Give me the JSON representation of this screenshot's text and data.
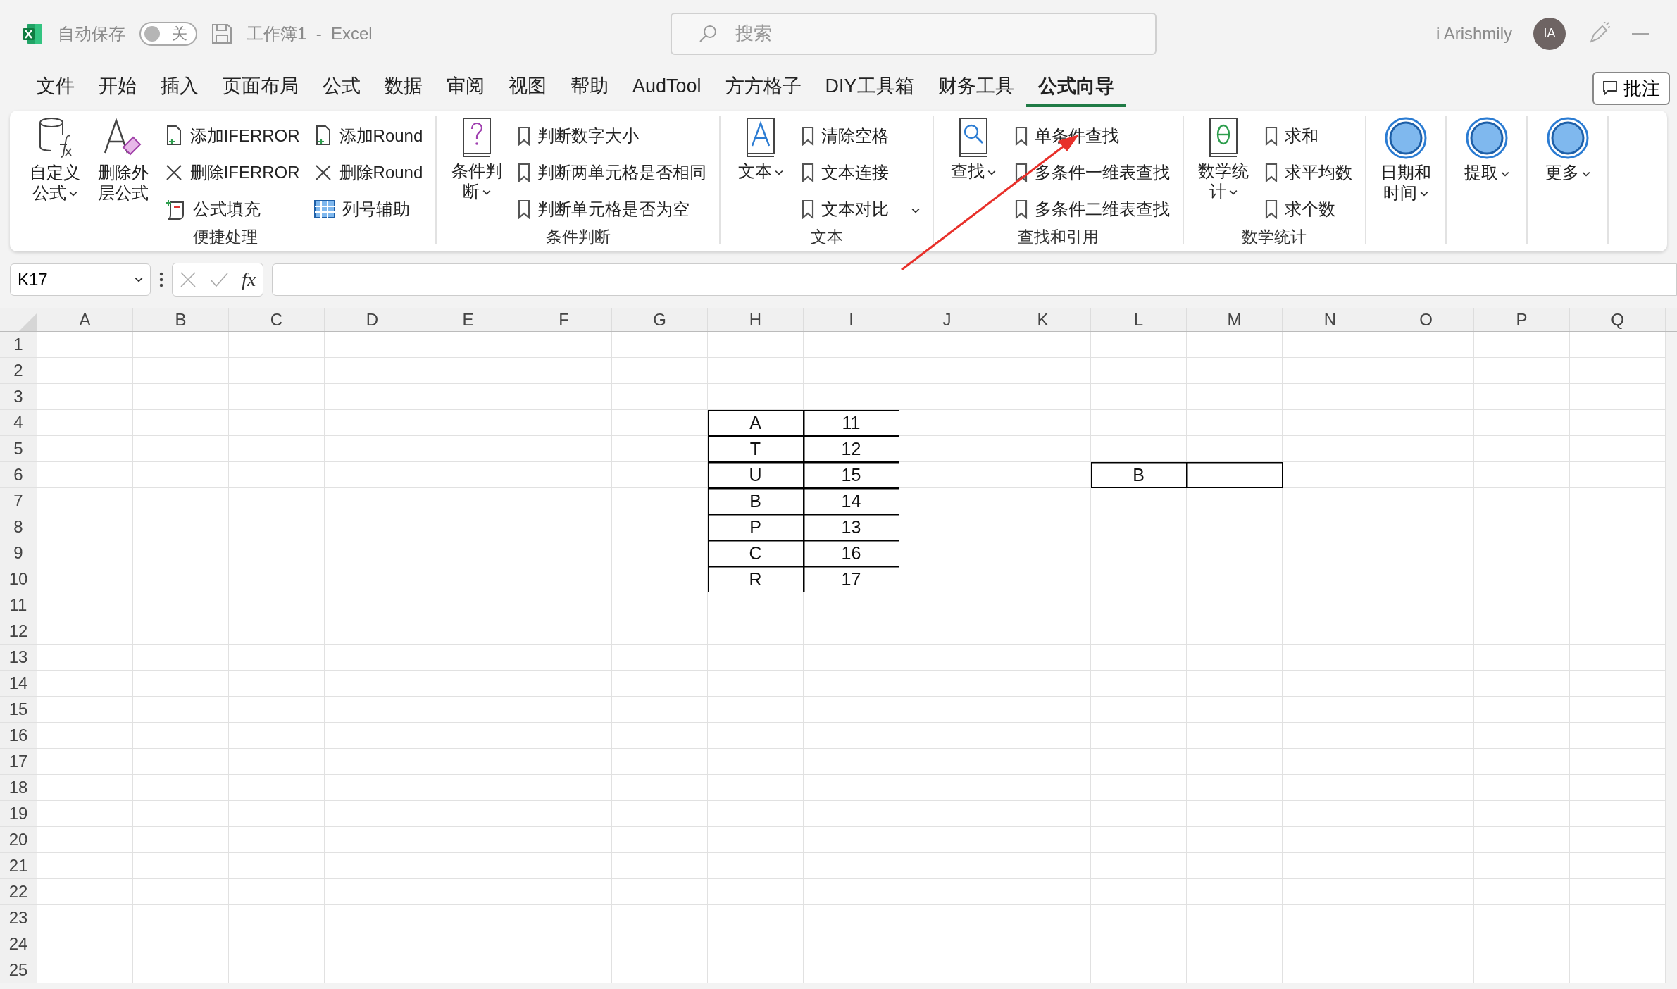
{
  "title_bar": {
    "autosave_label": "自动保存",
    "autosave_toggle": {
      "label": "关",
      "on": false
    },
    "document_title": "工作簿1  -  Excel",
    "search": {
      "placeholder": "搜索"
    },
    "user_name": "i Arishmily",
    "avatar_initials": "IA"
  },
  "menu_tabs": [
    {
      "label": "文件",
      "selected": false
    },
    {
      "label": "开始",
      "selected": false
    },
    {
      "label": "插入",
      "selected": false
    },
    {
      "label": "页面布局",
      "selected": false
    },
    {
      "label": "公式",
      "selected": false
    },
    {
      "label": "数据",
      "selected": false
    },
    {
      "label": "审阅",
      "selected": false
    },
    {
      "label": "视图",
      "selected": false
    },
    {
      "label": "帮助",
      "selected": false
    },
    {
      "label": "AudTool",
      "selected": false
    },
    {
      "label": "方方格子",
      "selected": false
    },
    {
      "label": "DIY工具箱",
      "selected": false
    },
    {
      "label": "财务工具",
      "selected": false
    },
    {
      "label": "公式向导",
      "selected": true
    }
  ],
  "comment_button": "批注",
  "ribbon_groups": [
    {
      "label": "便捷处理",
      "items": [
        {
          "kind": "cylinder",
          "label": "自定义公式",
          "dropdown": true
        },
        {
          "kind": "eraser",
          "label": "删除外层公式",
          "dropdown": false
        },
        {
          "kind": "addpage",
          "label": "添加IFERROR",
          "dropdown": false
        },
        {
          "kind": "cross",
          "label": "删除IFERROR",
          "dropdown": false
        },
        {
          "kind": "fill",
          "label": "公式填充",
          "dropdown": false
        },
        {
          "kind": "addpage",
          "label": "添加Round",
          "dropdown": false
        },
        {
          "kind": "cross",
          "label": "删除Round",
          "dropdown": false
        },
        {
          "kind": "grid",
          "label": "列号辅助",
          "dropdown": false
        }
      ]
    },
    {
      "label": "条件判断",
      "items": [
        {
          "kind": "questionbook",
          "label": "条件判断",
          "dropdown": true
        },
        {
          "kind": "bookmark",
          "label": "判断数字大小",
          "dropdown": false
        },
        {
          "kind": "bookmark",
          "label": "判断两单元格是否相同",
          "dropdown": false
        },
        {
          "kind": "bookmark",
          "label": "判断单元格是否为空",
          "dropdown": false
        }
      ]
    },
    {
      "label": "文本",
      "items": [
        {
          "kind": "letterbook",
          "label": "文本",
          "dropdown": true
        },
        {
          "kind": "bookmark",
          "label": "清除空格",
          "dropdown": false
        },
        {
          "kind": "bookmark",
          "label": "文本连接",
          "dropdown": false
        },
        {
          "kind": "bookmark",
          "label": "文本对比",
          "dropdown": true
        }
      ]
    },
    {
      "label": "查找和引用",
      "items": [
        {
          "kind": "searchbook",
          "label": "查找",
          "dropdown": true
        },
        {
          "kind": "bookmark",
          "label": "单条件查找",
          "dropdown": false
        },
        {
          "kind": "bookmark",
          "label": "多条件一维表查找",
          "dropdown": false
        },
        {
          "kind": "bookmark",
          "label": "多条件二维表查找",
          "dropdown": false
        }
      ]
    },
    {
      "label": "数学统计",
      "items": [
        {
          "kind": "thetabook",
          "label": "数学统计",
          "dropdown": true
        },
        {
          "kind": "bookmark",
          "label": "求和",
          "dropdown": false
        },
        {
          "kind": "bookmark",
          "label": "求平均数",
          "dropdown": false
        },
        {
          "kind": "bookmark",
          "label": "求个数",
          "dropdown": false
        }
      ]
    },
    {
      "items": [
        {
          "kind": "circle",
          "label": "日期和时间",
          "dropdown": true
        }
      ]
    },
    {
      "items": [
        {
          "kind": "circle",
          "label": "提取",
          "dropdown": true
        }
      ]
    },
    {
      "items": [
        {
          "kind": "circle",
          "label": "更多",
          "dropdown": true
        }
      ]
    }
  ],
  "formula_bar": {
    "name_box": "K17",
    "function_symbol": "fx"
  },
  "sheet": {
    "columns": [
      "A",
      "B",
      "C",
      "D",
      "E",
      "F",
      "G",
      "H",
      "I",
      "J",
      "K",
      "L",
      "M",
      "N",
      "O",
      "P",
      "Q"
    ],
    "rows": [
      "1",
      "2",
      "3",
      "4",
      "5",
      "6",
      "7",
      "8",
      "9",
      "10",
      "11",
      "12",
      "13",
      "14",
      "15",
      "16",
      "17",
      "18",
      "19",
      "20",
      "21",
      "22",
      "23",
      "24",
      "25"
    ],
    "table": [
      {
        "cells": [
          "A",
          "11"
        ]
      },
      {
        "cells": [
          "T",
          "12"
        ]
      },
      {
        "cells": [
          "U",
          "15"
        ]
      },
      {
        "cells": [
          "B",
          "14"
        ]
      },
      {
        "cells": [
          "P",
          "13"
        ]
      },
      {
        "cells": [
          "C",
          "16"
        ]
      },
      {
        "cells": [
          "R",
          "17"
        ]
      }
    ],
    "lookup_cells": [
      "B"
    ]
  }
}
